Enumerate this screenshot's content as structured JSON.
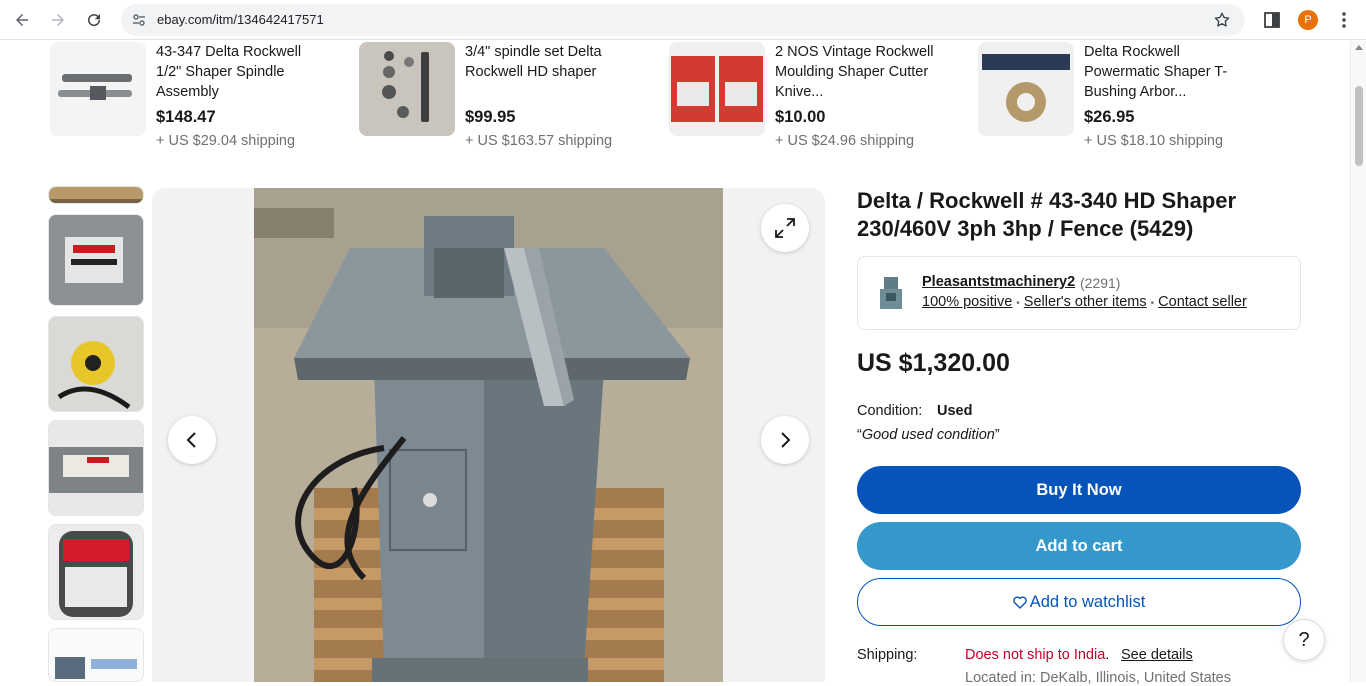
{
  "browser": {
    "url": "ebay.com/itm/134642417571",
    "profile_initial": "P"
  },
  "similar_items": [
    {
      "title": "43-347 Delta Rockwell 1/2\" Shaper Spindle Assembly",
      "price": "$148.47",
      "shipping": "+ US $29.04 shipping"
    },
    {
      "title": "3/4\" spindle set Delta Rockwell HD shaper",
      "price": "$99.95",
      "shipping": "+ US $163.57 shipping"
    },
    {
      "title": "2 NOS Vintage Rockwell Moulding Shaper Cutter Knive...",
      "price": "$10.00",
      "shipping": "+ US $24.96 shipping"
    },
    {
      "title": "Delta Rockwell Powermatic Shaper T-Bushing Arbor...",
      "price": "$26.95",
      "shipping": "+ US $18.10 shipping"
    }
  ],
  "listing": {
    "title": "Delta / Rockwell # 43-340 HD Shaper 230/460V 3ph 3hp / Fence (5429)",
    "seller": {
      "name": "Pleasantstmachinery2",
      "feedback_count": "(2291)",
      "positive": "100% positive",
      "other_items": "Seller's other items",
      "contact": "Contact seller"
    },
    "price": "US $1,320.00",
    "condition_label": "Condition:",
    "condition_value": "Used",
    "condition_quote": "Good used condition",
    "buttons": {
      "buy_now": "Buy It Now",
      "add_to_cart": "Add to cart",
      "watchlist": "Add to watchlist"
    },
    "shipping": {
      "label": "Shipping:",
      "value": "Does not ship to India",
      "link": "See details",
      "location": "Located in: DeKalb, Illinois, United States"
    }
  },
  "help_label": "?",
  "colors": {
    "buy_now": "#0654ba",
    "add_to_cart": "#3498ca",
    "shipping_warning": "#c4002a"
  }
}
